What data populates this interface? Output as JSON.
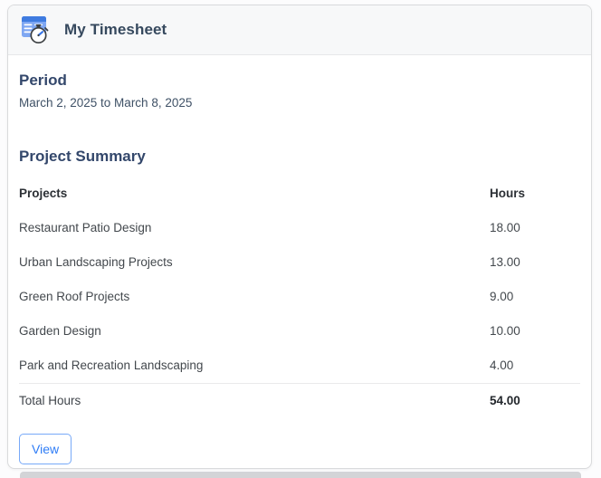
{
  "card": {
    "title": "My Timesheet",
    "icon": "timesheet-table-stopwatch-icon"
  },
  "period": {
    "heading": "Period",
    "range": "March 2, 2025 to March 8, 2025"
  },
  "summary": {
    "heading": "Project Summary",
    "table": {
      "columns": [
        "Projects",
        "Hours"
      ],
      "rows": [
        {
          "project": "Restaurant Patio Design",
          "hours": "18.00"
        },
        {
          "project": "Urban Landscaping Projects",
          "hours": "13.00"
        },
        {
          "project": "Green Roof Projects",
          "hours": "9.00"
        },
        {
          "project": "Garden Design",
          "hours": "10.00"
        },
        {
          "project": "Park and Recreation Landscaping",
          "hours": "4.00"
        }
      ],
      "total": {
        "label": "Total Hours",
        "hours": "54.00"
      }
    }
  },
  "actions": {
    "view_label": "View"
  },
  "colors": {
    "heading_navy": "#33476b",
    "title_slate": "#36495e",
    "table_icon_blue": "#7fa7f2",
    "table_icon_header_blue": "#3f7be0",
    "button_blue": "#2e7cf6",
    "button_border_blue": "#77a9f8",
    "card_border": "#d9dadc",
    "header_bg": "#f7f8f9",
    "separator": "#e9eaeb",
    "next_card_edge_gray": "#d3d4d7"
  }
}
